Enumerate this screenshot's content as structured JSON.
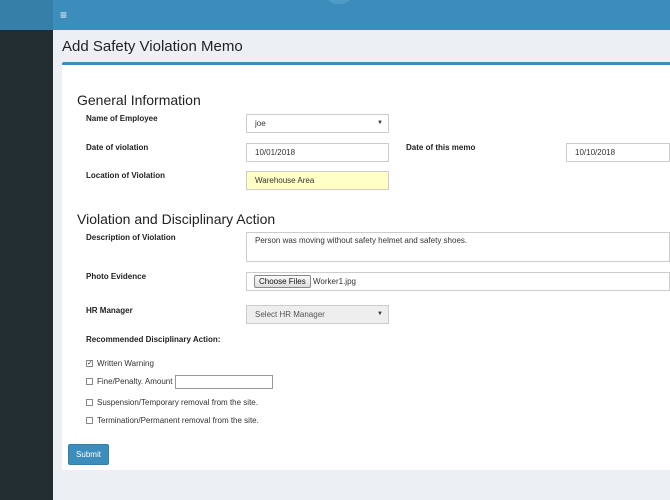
{
  "topbar": {
    "menu_icon": "hamburger-icon",
    "menu_glyph": "≡"
  },
  "page": {
    "title": "Add Safety Violation Memo"
  },
  "general": {
    "heading": "General Information",
    "employee_label": "Name of Employee",
    "employee_value": "joe",
    "violation_date_label": "Date of violation",
    "violation_date_value": "10/01/2018",
    "memo_date_label": "Date of this memo",
    "memo_date_value": "10/10/2018",
    "location_label": "Location of Violation",
    "location_value": "Warehouse Area"
  },
  "violation": {
    "heading": "Violation and Disciplinary Action",
    "description_label": "Description of Violation",
    "description_value": "Person was moving without safety helmet and safety shoes.",
    "photo_label": "Photo Evidence",
    "choose_files_label": "Choose Files",
    "file_name": "Worker1.jpg",
    "hr_label": "HR Manager",
    "hr_value": "Select HR Manager",
    "recommended_label": "Recommended Disciplinary Action:",
    "actions": [
      {
        "label": "Written Warning",
        "checked": true
      },
      {
        "label": "Fine/Penalty. Amount",
        "checked": false
      },
      {
        "label": "Suspension/Temporary removal from the site.",
        "checked": false
      },
      {
        "label": "Termination/Permanent removal from the site.",
        "checked": false
      }
    ],
    "fine_amount_value": ""
  },
  "form": {
    "submit_label": "Submit"
  },
  "colors": {
    "header_blue": "#3c8dbc",
    "sidebar_dark": "#222d32",
    "highlight_yellow": "#ffffc6"
  }
}
